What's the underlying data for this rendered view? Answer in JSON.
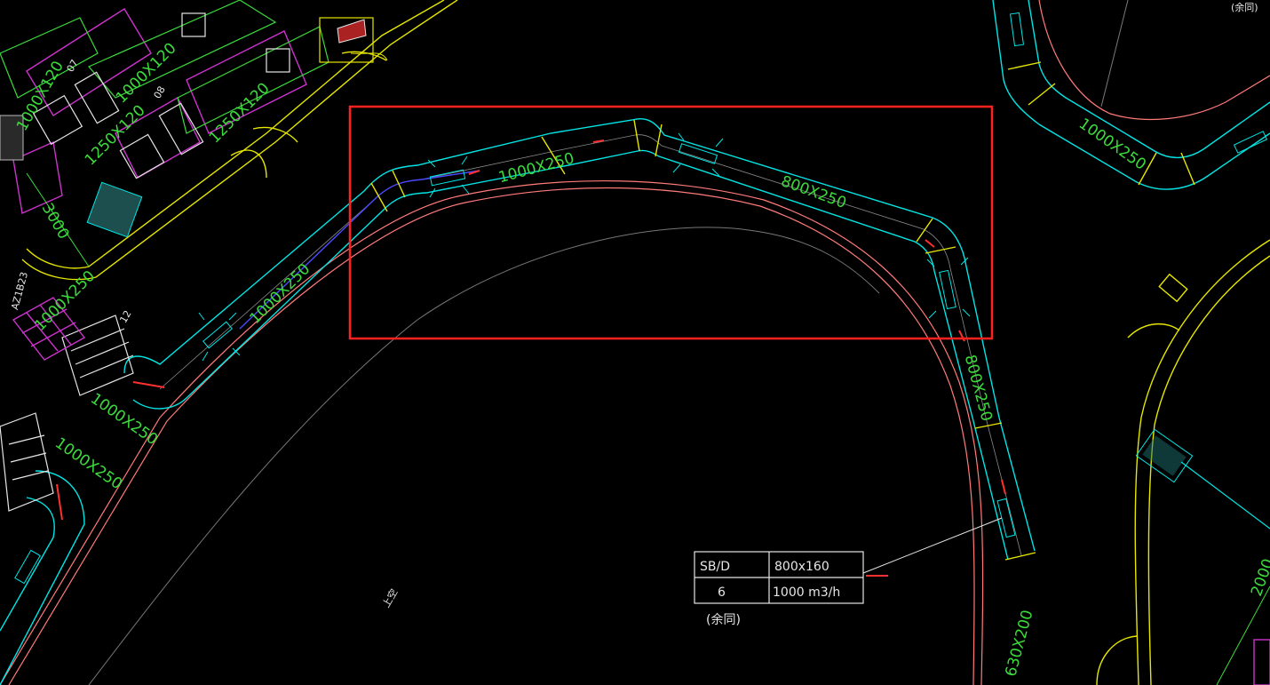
{
  "colors": {
    "background": "#000000",
    "duct": "#00e5e5",
    "centerline": "#8a8a8a",
    "wall": "#ff7a7a",
    "blue_line": "#4a4aff",
    "yellow": "#e6e600",
    "magenta": "#cc33cc",
    "label_green": "#3cdc3c",
    "selection_box": "#ff2020",
    "white": "#e6e6e6"
  },
  "duct_labels": {
    "main_left": "1000X250",
    "main_top": "1000X250",
    "main_right": "800X250",
    "right_vertical": "800X250",
    "bottom_right": "630X200",
    "top_right": "1000X250",
    "lower_left_1": "1000X250",
    "lower_left_2": "1000X250",
    "upper_left_1": "1000X120",
    "upper_left_2": "1250X120",
    "upper_left_3": "1250X120",
    "upper_left_4": "1000X120",
    "small_left": "1000X250"
  },
  "annotations": {
    "dim_3000": "3000",
    "dim_2000": "2000",
    "tag_07": "07",
    "tag_08": "08",
    "tag_12": "12",
    "up_label": "上空",
    "same_top": "(余同)",
    "tag_side": "AZ1B23"
  },
  "spec_table": {
    "row1_col1": "SB/D",
    "row1_col2": "800x160",
    "row2_col1": "6",
    "row2_col2": "1000 m3/h",
    "note": "(余同)"
  }
}
